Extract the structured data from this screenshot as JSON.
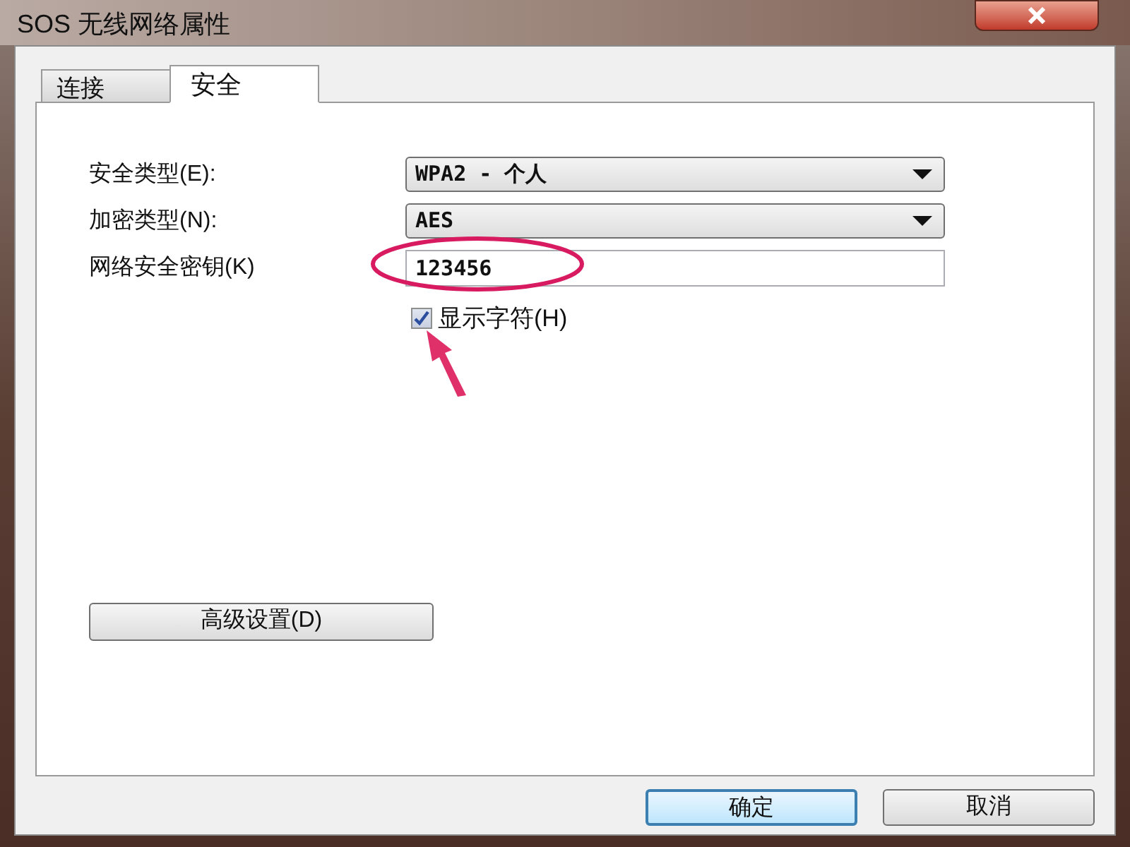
{
  "window": {
    "title": "SOS 无线网络属性"
  },
  "tabs": [
    {
      "label": "连接",
      "selected": false
    },
    {
      "label": "安全",
      "selected": true
    }
  ],
  "fields": [
    {
      "kind": "dropdown",
      "label": "安全类型(E):",
      "value": "WPA2 - 个人"
    },
    {
      "kind": "dropdown",
      "label": "加密类型(N):",
      "value": "AES"
    },
    {
      "kind": "text",
      "label": "网络安全密钥(K)",
      "value": "123456"
    }
  ],
  "show_characters": {
    "label": "显示字符(H)",
    "checked": true
  },
  "advanced_button": "高级设置(D)",
  "buttons": [
    {
      "label": "确定",
      "default": true
    },
    {
      "label": "取消",
      "default": false
    }
  ]
}
